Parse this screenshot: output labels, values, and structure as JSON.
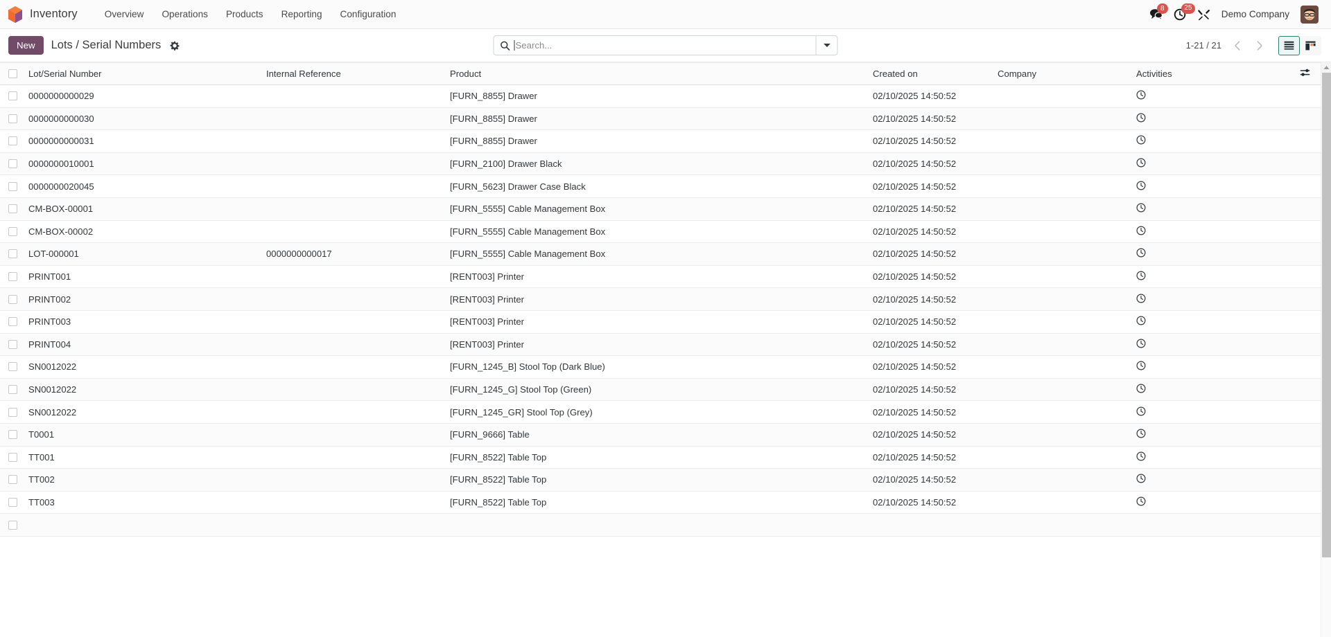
{
  "navbar": {
    "brand": "Inventory",
    "logo_icon": "odoo-cube-logo",
    "menu_items": [
      {
        "label": "Overview"
      },
      {
        "label": "Operations"
      },
      {
        "label": "Products"
      },
      {
        "label": "Reporting"
      },
      {
        "label": "Configuration"
      }
    ],
    "messages": {
      "icon": "messages-icon",
      "count": "8"
    },
    "activities": {
      "icon": "clock-activities-icon",
      "count": "25"
    },
    "debug": {
      "icon": "wrench-screwdriver-icon"
    },
    "company": "Demo Company",
    "avatar_icon": "user-avatar"
  },
  "control_panel": {
    "new_label": "New",
    "title": "Lots / Serial Numbers",
    "gear_icon": "gear-icon",
    "search": {
      "icon": "search-icon",
      "placeholder": "Search...",
      "value": "",
      "toggle_icon": "chevron-down-icon"
    },
    "pager": {
      "range": "1-21 / 21",
      "prev_icon": "chevron-left-icon",
      "next_icon": "chevron-right-icon"
    },
    "views": [
      {
        "name": "list",
        "icon": "list-view-icon",
        "active": true
      },
      {
        "name": "kanban",
        "icon": "kanban-view-icon",
        "active": false
      }
    ]
  },
  "table": {
    "columns": [
      {
        "key": "lot",
        "label": "Lot/Serial Number"
      },
      {
        "key": "ref",
        "label": "Internal Reference"
      },
      {
        "key": "product",
        "label": "Product"
      },
      {
        "key": "created",
        "label": "Created on"
      },
      {
        "key": "company",
        "label": "Company"
      },
      {
        "key": "activities",
        "label": "Activities"
      }
    ],
    "optional_columns_icon": "sliders-toggle-icon",
    "activity_icon": "clock-icon",
    "rows": [
      {
        "lot": "0000000000029",
        "ref": "",
        "product": "[FURN_8855] Drawer",
        "created": "02/10/2025 14:50:52",
        "company": ""
      },
      {
        "lot": "0000000000030",
        "ref": "",
        "product": "[FURN_8855] Drawer",
        "created": "02/10/2025 14:50:52",
        "company": ""
      },
      {
        "lot": "0000000000031",
        "ref": "",
        "product": "[FURN_8855] Drawer",
        "created": "02/10/2025 14:50:52",
        "company": ""
      },
      {
        "lot": "0000000010001",
        "ref": "",
        "product": "[FURN_2100] Drawer Black",
        "created": "02/10/2025 14:50:52",
        "company": ""
      },
      {
        "lot": "0000000020045",
        "ref": "",
        "product": "[FURN_5623] Drawer Case Black",
        "created": "02/10/2025 14:50:52",
        "company": ""
      },
      {
        "lot": "CM-BOX-00001",
        "ref": "",
        "product": "[FURN_5555] Cable Management Box",
        "created": "02/10/2025 14:50:52",
        "company": ""
      },
      {
        "lot": "CM-BOX-00002",
        "ref": "",
        "product": "[FURN_5555] Cable Management Box",
        "created": "02/10/2025 14:50:52",
        "company": ""
      },
      {
        "lot": "LOT-000001",
        "ref": "0000000000017",
        "product": "[FURN_5555] Cable Management Box",
        "created": "02/10/2025 14:50:52",
        "company": ""
      },
      {
        "lot": "PRINT001",
        "ref": "",
        "product": "[RENT003] Printer",
        "created": "02/10/2025 14:50:52",
        "company": ""
      },
      {
        "lot": "PRINT002",
        "ref": "",
        "product": "[RENT003] Printer",
        "created": "02/10/2025 14:50:52",
        "company": ""
      },
      {
        "lot": "PRINT003",
        "ref": "",
        "product": "[RENT003] Printer",
        "created": "02/10/2025 14:50:52",
        "company": ""
      },
      {
        "lot": "PRINT004",
        "ref": "",
        "product": "[RENT003] Printer",
        "created": "02/10/2025 14:50:52",
        "company": ""
      },
      {
        "lot": "SN0012022",
        "ref": "",
        "product": "[FURN_1245_B] Stool Top (Dark Blue)",
        "created": "02/10/2025 14:50:52",
        "company": ""
      },
      {
        "lot": "SN0012022",
        "ref": "",
        "product": "[FURN_1245_G] Stool Top (Green)",
        "created": "02/10/2025 14:50:52",
        "company": ""
      },
      {
        "lot": "SN0012022",
        "ref": "",
        "product": "[FURN_1245_GR] Stool Top (Grey)",
        "created": "02/10/2025 14:50:52",
        "company": ""
      },
      {
        "lot": "T0001",
        "ref": "",
        "product": "[FURN_9666] Table",
        "created": "02/10/2025 14:50:52",
        "company": ""
      },
      {
        "lot": "TT001",
        "ref": "",
        "product": "[FURN_8522] Table Top",
        "created": "02/10/2025 14:50:52",
        "company": ""
      },
      {
        "lot": "TT002",
        "ref": "",
        "product": "[FURN_8522] Table Top",
        "created": "02/10/2025 14:50:52",
        "company": ""
      },
      {
        "lot": "TT003",
        "ref": "",
        "product": "[FURN_8522] Table Top",
        "created": "02/10/2025 14:50:52",
        "company": ""
      },
      {
        "lot": "",
        "ref": "",
        "product": "",
        "created": "",
        "company": ""
      }
    ]
  },
  "colors": {
    "primary": "#714B67",
    "badge": "#d9534f",
    "accent_active": "#2e7d73",
    "logo_orange": "#f06a35",
    "logo_purple": "#8f4f8b"
  }
}
